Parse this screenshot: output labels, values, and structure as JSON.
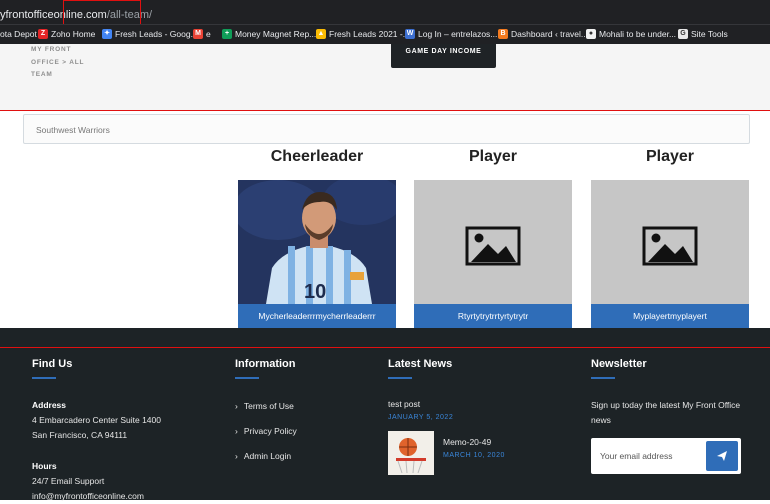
{
  "browser": {
    "url_main": "yfrontofficeonline.com",
    "url_path": "/all-team/",
    "bookmarks": [
      {
        "label": "ota Depot",
        "color": "#202124",
        "glyph": ""
      },
      {
        "label": "Zoho Home",
        "color": "#e42527",
        "glyph": "Z"
      },
      {
        "label": "Fresh Leads - Goog...",
        "color": "#4285f4",
        "glyph": "✦"
      },
      {
        "label": "e",
        "color": "#ea4335",
        "glyph": "M"
      },
      {
        "label": "Money Magnet Rep...",
        "color": "#0f9d58",
        "glyph": "+"
      },
      {
        "label": "Fresh Leads 2021 -...",
        "color": "#fbbc04",
        "glyph": "▲"
      },
      {
        "label": "Log In – entrelazos...",
        "color": "#3c6fd1",
        "glyph": "W"
      },
      {
        "label": "Dashboard ‹ travel...",
        "color": "#f47b20",
        "glyph": "B"
      },
      {
        "label": "Mohali to be under...",
        "color": "#f1f1f1",
        "glyph": "●"
      },
      {
        "label": "Site Tools",
        "color": "#e8e8e8",
        "glyph": "G"
      }
    ]
  },
  "page": {
    "breadcrumb": "MY FRONT OFFICE > ALL TEAM",
    "game_day_button": "GAME DAY INCOME",
    "team_select": "Southwest Warriors"
  },
  "cards": [
    {
      "role": "Cheerleader",
      "name": "Mycherleaderrrmycherrleaderrr",
      "has_photo": true
    },
    {
      "role": "Player",
      "name": "Rtyrtytrytrrtyrtytrytr",
      "has_photo": false
    },
    {
      "role": "Player",
      "name": "Myplayertmyplayert",
      "has_photo": false
    }
  ],
  "footer": {
    "find_us": {
      "title": "Find Us",
      "address_label": "Address",
      "address_line1": "4 Embarcadero Center Suite 1400",
      "address_line2": "San Francisco, CA 94111",
      "hours_label": "Hours",
      "hours_value": "24/7 Email Support",
      "email": "info@myfrontofficeonline.com"
    },
    "information": {
      "title": "Information",
      "links": [
        "Terms of Use",
        "Privacy Policy",
        "Admin Login"
      ]
    },
    "latest_news": {
      "title": "Latest News",
      "post1_title": "test post",
      "post1_date": "JANUARY 5, 2022",
      "post2_title": "Memo-20-49",
      "post2_date": "MARCH 10, 2020"
    },
    "newsletter": {
      "title": "Newsletter",
      "text": "Sign up today the latest My Front Office news",
      "placeholder": "Your email address"
    }
  },
  "colors": {
    "accent": "#2f6db8",
    "footer_bg": "#1d2326",
    "highlight": "#e01010"
  }
}
